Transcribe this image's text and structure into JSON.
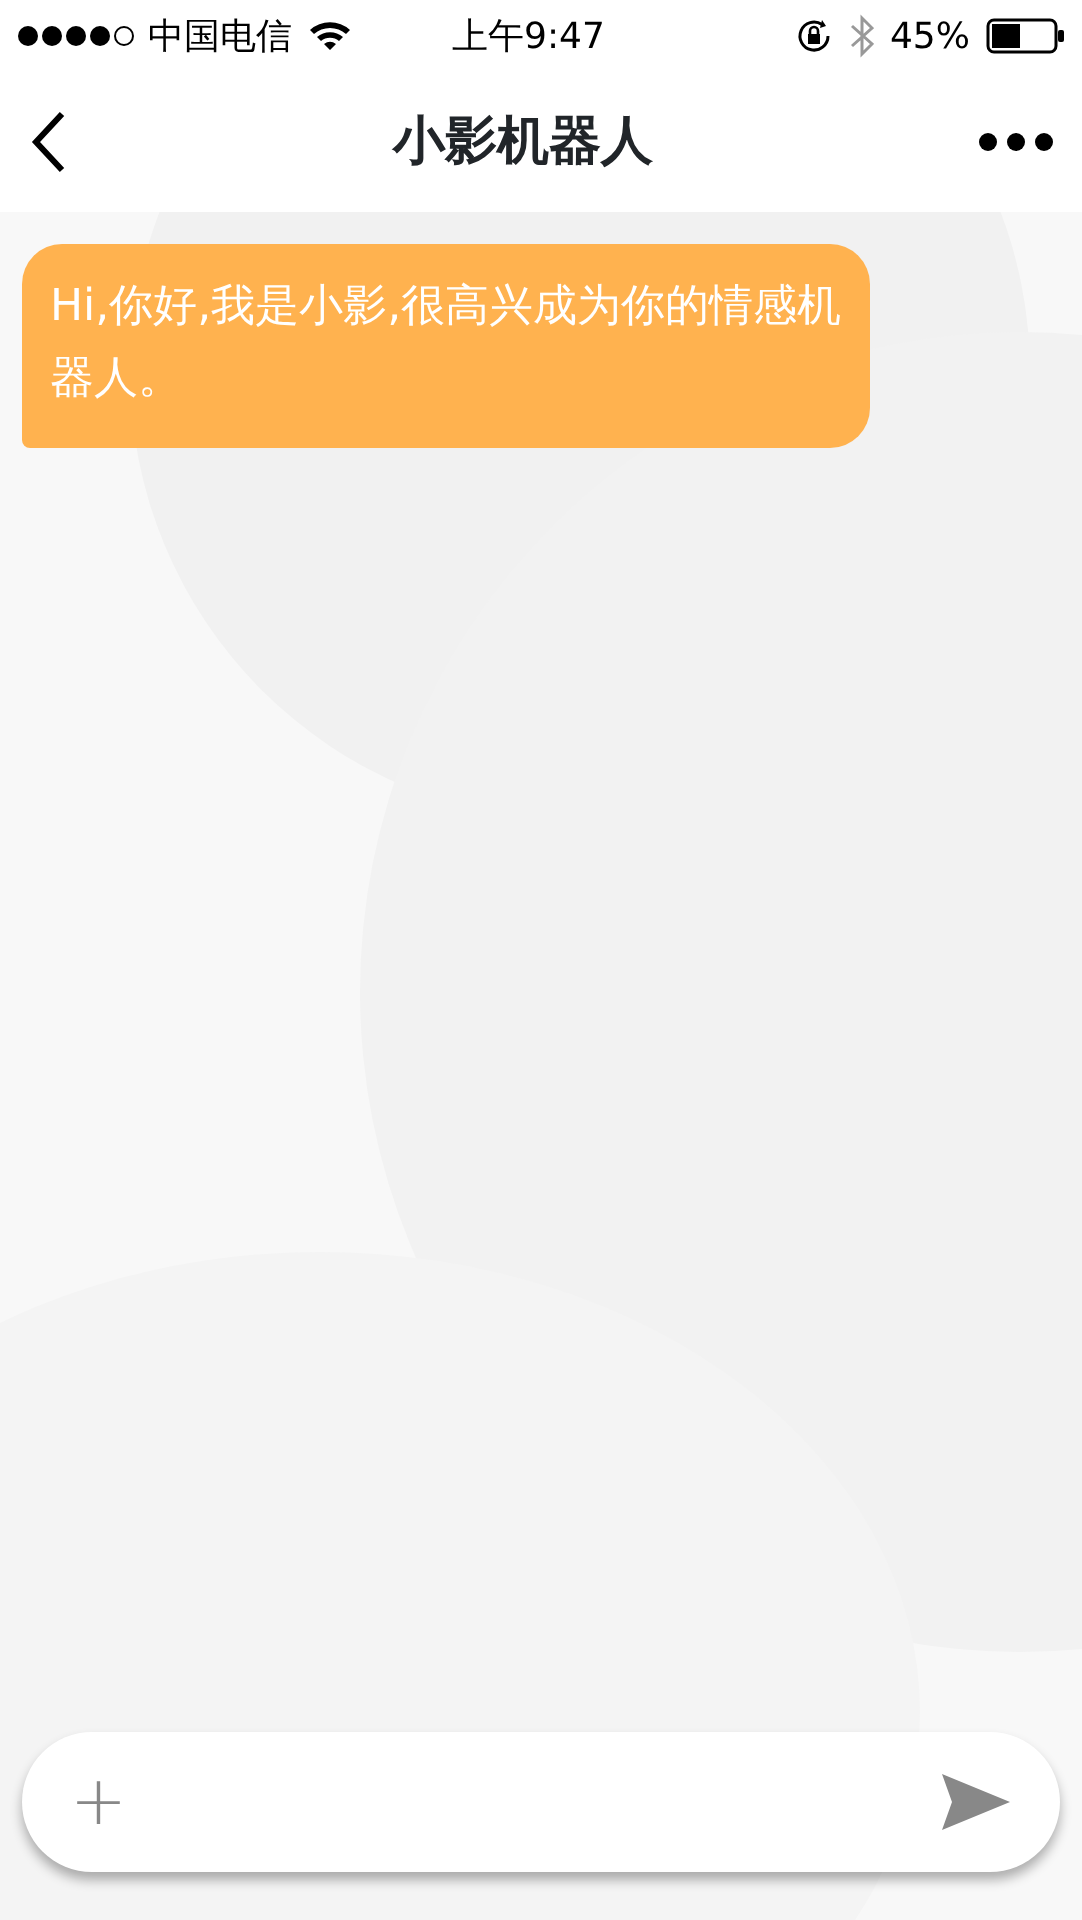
{
  "status_bar": {
    "carrier": "中国电信",
    "time": "上午9:47",
    "battery": "45%"
  },
  "nav": {
    "title": "小影机器人"
  },
  "messages": [
    {
      "kind": "bot",
      "text": "Hi,你好,我是小影,很高兴成为你的情感机器人。"
    }
  ],
  "input_bar": {
    "add": "+"
  }
}
